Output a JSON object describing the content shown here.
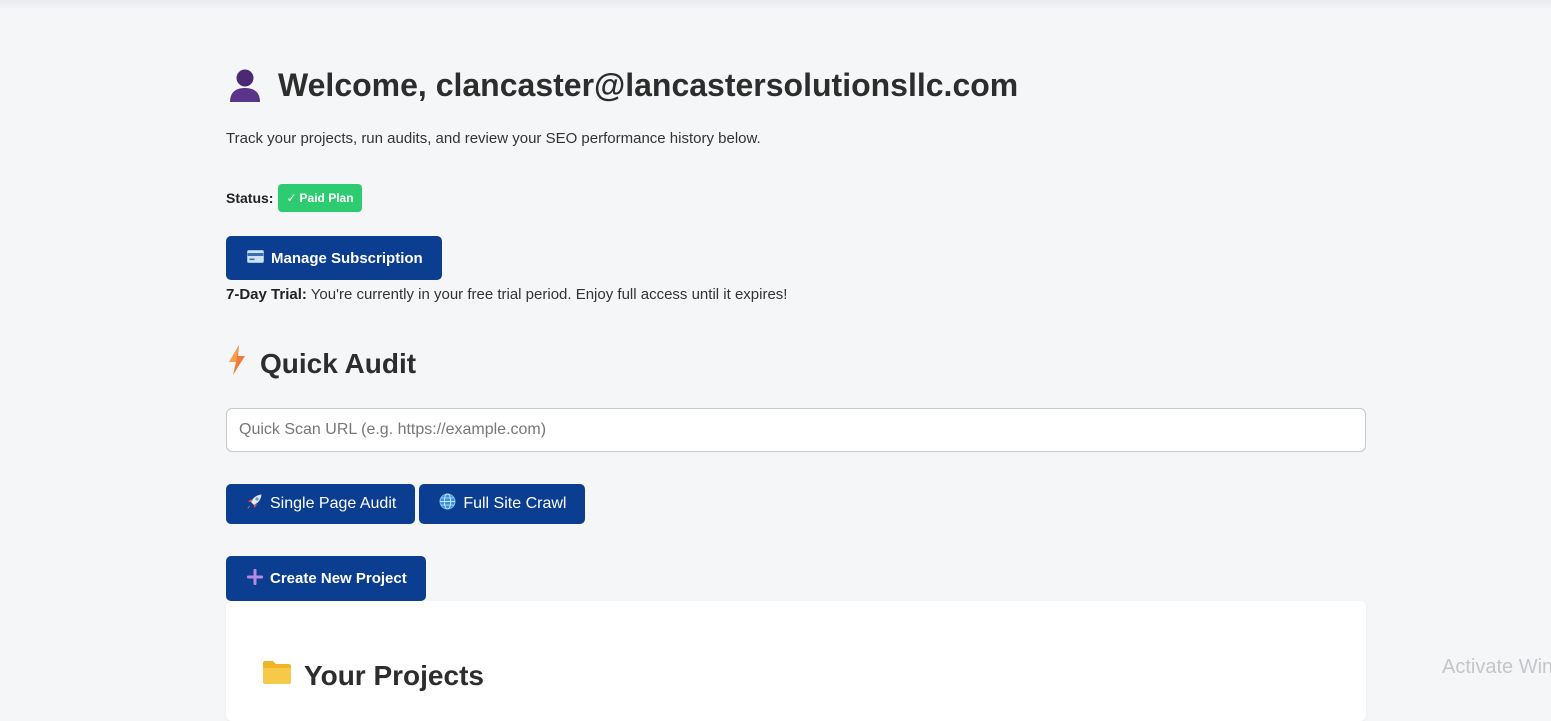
{
  "header": {
    "welcome_text": "Welcome, clancaster@lancastersolutionsllc.com",
    "subtitle": "Track your projects, run audits, and review your SEO performance history below."
  },
  "status": {
    "label": "Status:",
    "badge_check": "✓",
    "badge_text": "Paid Plan",
    "badge_color": "#2ecc71"
  },
  "subscription": {
    "button_label": "Manage Subscription",
    "icon": "credit-card-icon",
    "trial_label": "7-Day Trial:",
    "trial_text": " You're currently in your free trial period. Enjoy full access until it expires!"
  },
  "quick_audit": {
    "title": "Quick Audit",
    "icon": "lightning-icon",
    "url_placeholder": "Quick Scan URL (e.g. https://example.com)",
    "url_value": "",
    "single_page_label": "Single Page Audit",
    "single_page_icon": "rocket-icon",
    "full_site_label": "Full Site Crawl",
    "full_site_icon": "globe-icon"
  },
  "projects": {
    "create_label": "Create New Project",
    "create_icon": "plus-icon",
    "heading": "Your Projects",
    "heading_icon": "folder-icon"
  },
  "watermark": "Activate Windows",
  "colors": {
    "primary": "#0b3d91",
    "background": "#f4f6f8"
  }
}
